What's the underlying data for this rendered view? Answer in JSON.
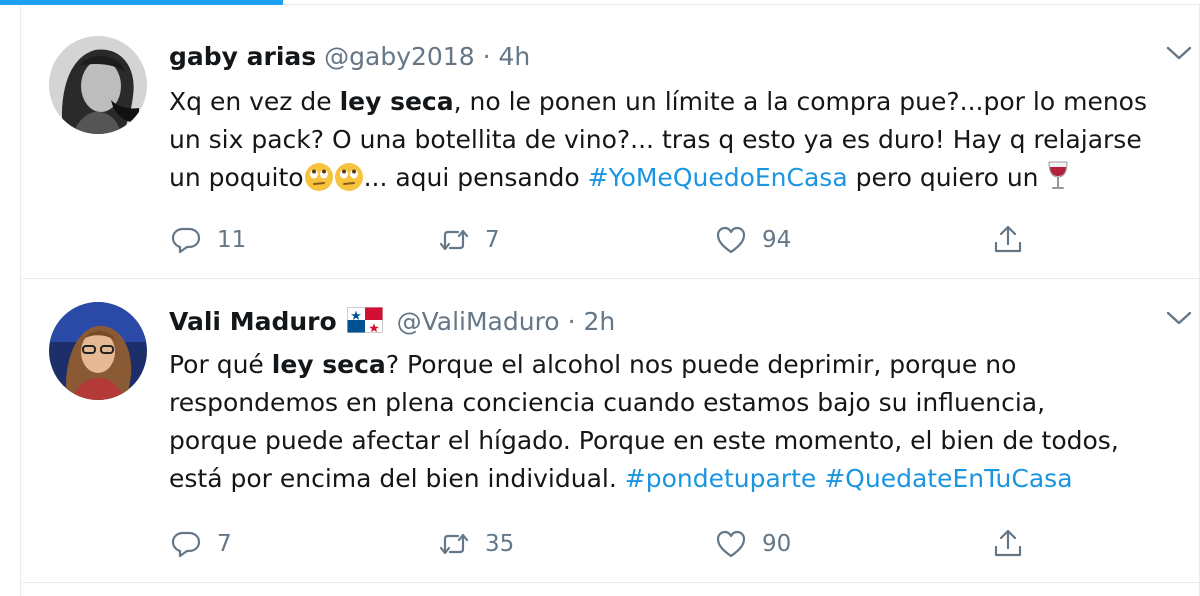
{
  "tweets": [
    {
      "display_name": "gaby arias",
      "handle": "@gaby2018",
      "separator": "·",
      "time": "4h",
      "body": {
        "l1_a": "Xq en vez de ",
        "l1_b": "ley seca",
        "l1_c": ", no le ponen un límite a la compra pue?...por lo menos",
        "l2": "un six pack? O una botellita de vino?... tras q esto ya es duro! Hay q relajarse",
        "l3_a": "un poquito",
        "l3_b": "... aqui pensando ",
        "l3_hashtag": "#YoMeQuedoEnCasa",
        "l3_c": " pero quiero un "
      },
      "replies": "11",
      "retweets": "7",
      "likes": "94"
    },
    {
      "display_name": "Vali Maduro",
      "handle": "@ValiMaduro",
      "separator": "·",
      "time": "2h",
      "body": {
        "l1_a": "Por qué ",
        "l1_b": "ley seca",
        "l1_c": "? Porque el alcohol nos puede deprimir, porque no",
        "l2": "respondemos en plena conciencia cuando estamos bajo su influencia,",
        "l3": "porque puede afectar el hígado. Porque en este momento, el bien de todos,",
        "l4_a": "está por encima del bien individual. ",
        "l4_hashtag1": "#pondetuparte",
        "l4_sep": " ",
        "l4_hashtag2": "#QuedateEnTuCasa"
      },
      "replies": "7",
      "retweets": "35",
      "likes": "90"
    }
  ],
  "colors": {
    "accent": "#1da1f2",
    "hashtag": "#1b95e0",
    "meta_text": "#657786",
    "divider": "#e6ecf0"
  },
  "icons": [
    "reply-icon",
    "retweet-icon",
    "like-icon",
    "share-icon",
    "caret-down-icon",
    "rolling-eyes-emoji",
    "wine-glass-emoji",
    "panama-flag-emoji"
  ]
}
